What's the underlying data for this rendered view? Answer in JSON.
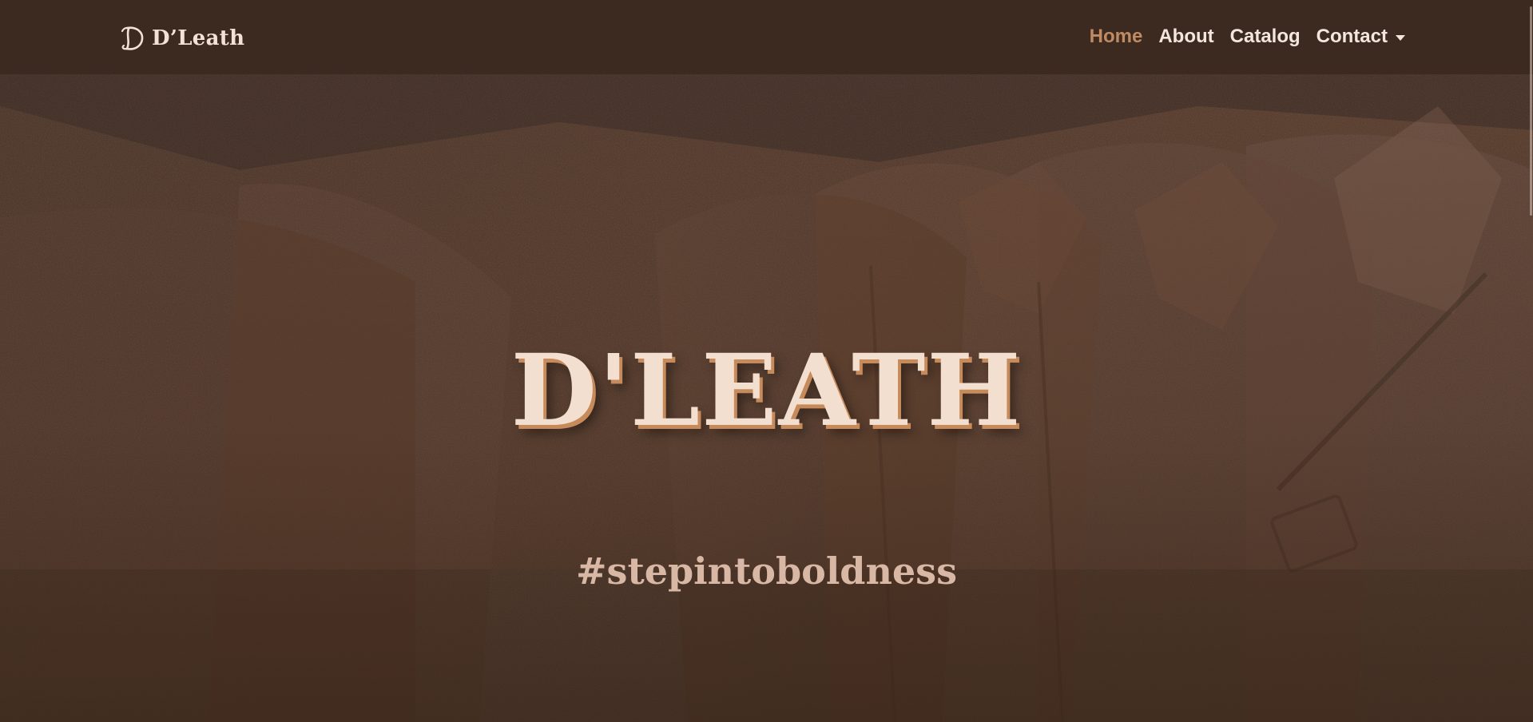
{
  "brand": {
    "name": "D’Leath",
    "mark_icon": "d-monogram-icon"
  },
  "nav": {
    "items": [
      {
        "label": "Home",
        "active": true
      },
      {
        "label": "About"
      },
      {
        "label": "Catalog"
      },
      {
        "label": "Contact",
        "has_dropdown": true
      }
    ]
  },
  "hero": {
    "title": "D'LEATH",
    "tagline": "#stepintoboldness",
    "background": "leather-jackets-photo"
  },
  "colors": {
    "navbar_bg": "#3c2a20",
    "accent": "#c08a62",
    "nav_text": "#f3e6dc",
    "title": "#f3dfd0",
    "title_shadow": "#c78a5b",
    "tagline": "#d8b7a4"
  }
}
